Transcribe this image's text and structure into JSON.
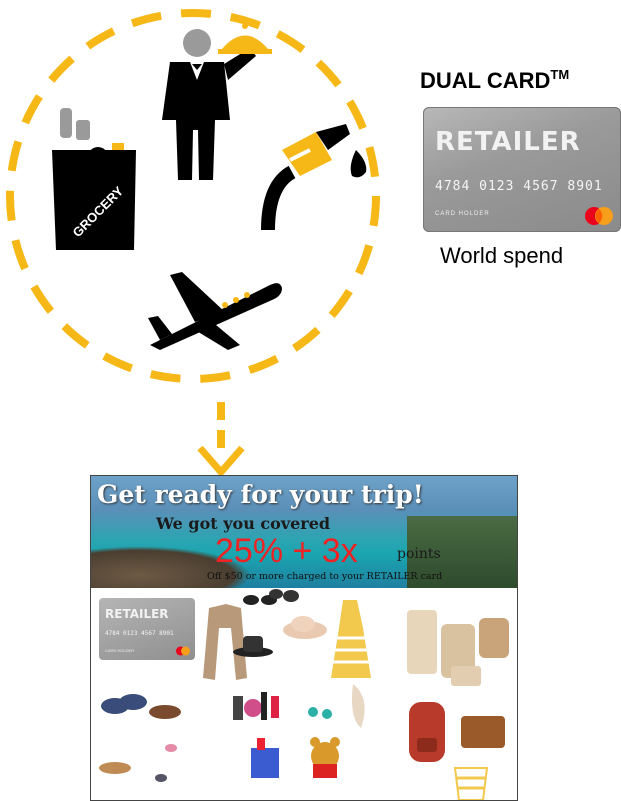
{
  "card": {
    "title": "DUAL CARD",
    "title_mark": "TM",
    "brand": "RETAILER",
    "number": "4784 0123 4567 8901",
    "holder": "CARD HOLDER",
    "network_logo_text": "MasterCard"
  },
  "caption": "World spend",
  "icons": [
    "waiter-icon",
    "grocery-bag-icon",
    "fuel-pump-icon",
    "airplane-icon",
    "down-arrow-icon"
  ],
  "grocery_label": "GROCERY",
  "promo": {
    "headline": "Get ready for your trip!",
    "subheadline": "We got you covered",
    "offer": "25% + 3x",
    "points": "points",
    "fineprint": "Off $50 or more charged to your RETAILER card",
    "mini_card": {
      "brand": "RETAILER",
      "number": "4784 0123 4567 8901",
      "holder": "CARD HOLDER"
    }
  },
  "colors": {
    "accent": "#F6B817",
    "dark": "#000000",
    "offer_red": "#EE2222"
  }
}
